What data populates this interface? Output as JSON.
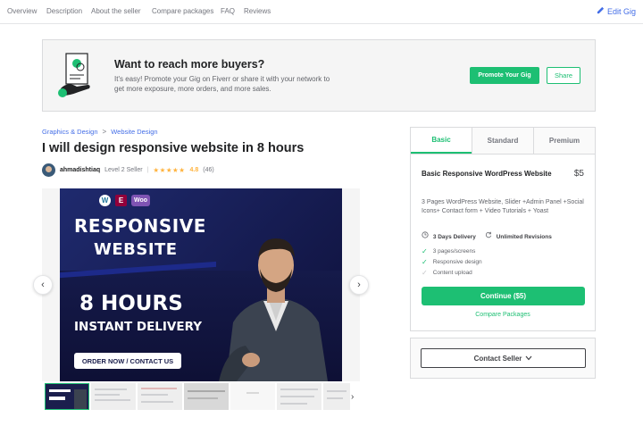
{
  "nav": {
    "links": [
      "Overview",
      "Description",
      "About the seller",
      "Compare packages",
      "FAQ",
      "Reviews"
    ],
    "edit_label": "Edit Gig"
  },
  "promo": {
    "title": "Want to reach more buyers?",
    "text": "It's easy! Promote your Gig on Fiverr or share it with your network to get more exposure, more orders, and more sales.",
    "promote_label": "Promote Your Gig",
    "share_label": "Share"
  },
  "breadcrumb": {
    "items": [
      "Graphics & Design",
      "Website Design"
    ],
    "separator": ">"
  },
  "gig": {
    "title": "I will design responsive website in 8 hours"
  },
  "seller": {
    "name": "ahmadishtiaq",
    "level": "Level 2 Seller",
    "stars": "★★★★★",
    "rating": "4.8",
    "reviews": "(46)"
  },
  "slide": {
    "logo_wp": "W",
    "logo_el": "E",
    "logo_woo": "Woo",
    "line1": "RESPONSIVE",
    "line2": "WEBSITE",
    "line3": "8 HOURS",
    "line4": "INSTANT DELIVERY",
    "cta": "ORDER NOW / CONTACT US"
  },
  "gallery": {
    "prev_glyph": "‹",
    "next_glyph": "›",
    "thumbs_next_glyph": "›"
  },
  "package": {
    "tabs": [
      "Basic",
      "Standard",
      "Premium"
    ],
    "active_tab": "Basic",
    "name": "Basic Responsive WordPress Website",
    "price": "$5",
    "description": "3 Pages WordPress Website, Slider +Admin Panel +Social Icons+ Contact form + Video Tutorials + Yoast",
    "delivery": "3 Days Delivery",
    "revisions": "Unlimited Revisions",
    "features": [
      {
        "label": "3 pages/screens",
        "included": true
      },
      {
        "label": "Responsive design",
        "included": true
      },
      {
        "label": "Content upload",
        "included": false
      }
    ],
    "continue_label": "Continue ($5)",
    "compare_label": "Compare Packages"
  },
  "contact": {
    "label": "Contact Seller"
  },
  "colors": {
    "brand_green": "#1dbf73",
    "link_blue": "#446ee7",
    "star": "#ffb33e",
    "slide_bg": "#1b1f4d"
  }
}
